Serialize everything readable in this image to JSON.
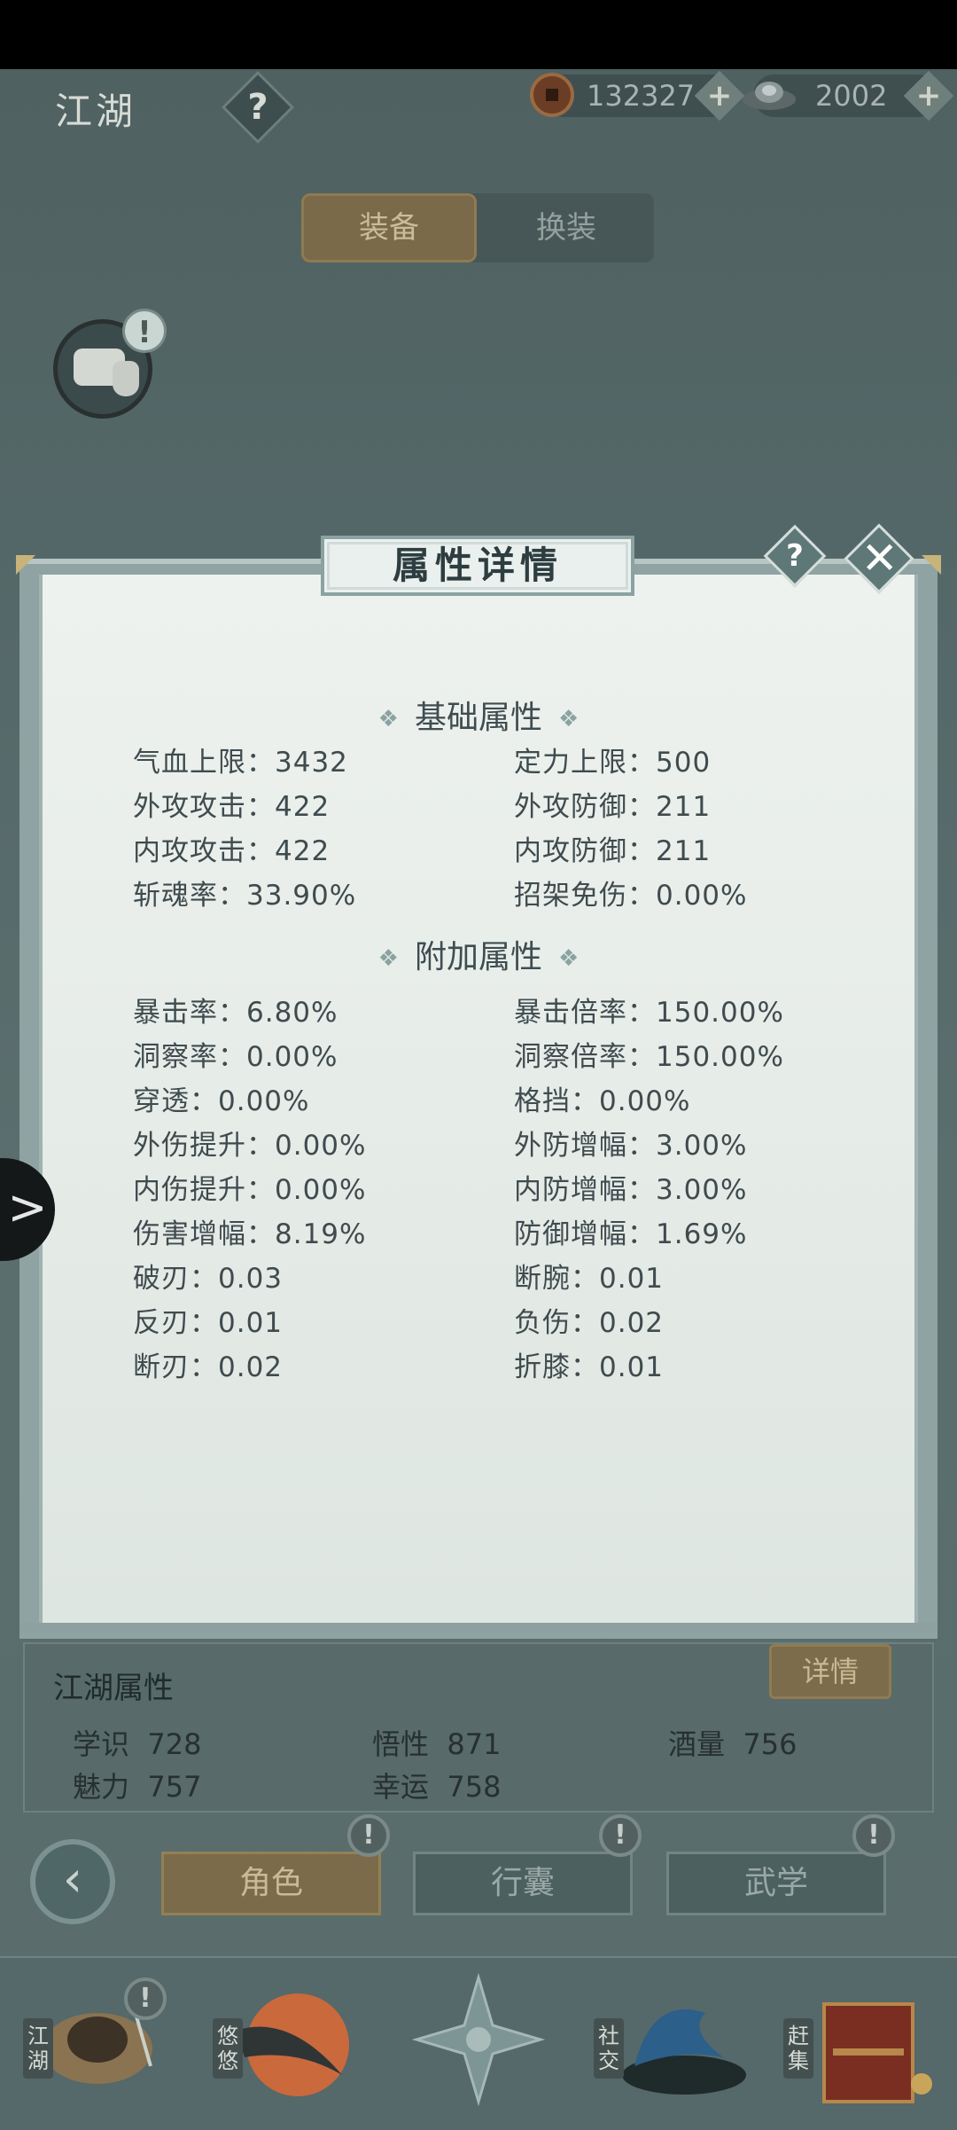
{
  "header": {
    "title": "江湖",
    "help": "?",
    "coins": "132327",
    "ingots": "2002",
    "plus": "+"
  },
  "tabs": {
    "equip": "装备",
    "change": "换装"
  },
  "chat": {
    "alert": "!"
  },
  "modal": {
    "title": "属性详情",
    "help": "?",
    "close": "✕",
    "base_section": "基础属性",
    "extra_section": "附加属性",
    "section_mark": "❖",
    "base_left": [
      "气血上限：3432",
      "外攻攻击：422",
      "内攻攻击：422",
      "斩魂率：33.90%"
    ],
    "base_right": [
      "定力上限：500",
      "外攻防御：211",
      "内攻防御：211",
      "招架免伤：0.00%"
    ],
    "extra_left": [
      "暴击率：6.80%",
      "洞察率：0.00%",
      "穿透：0.00%",
      "外伤提升：0.00%",
      "内伤提升：0.00%",
      "伤害增幅：8.19%",
      "破刃：0.03",
      "反刃：0.01",
      "断刃：0.02"
    ],
    "extra_right": [
      "暴击倍率：150.00%",
      "洞察倍率：150.00%",
      "格挡：0.00%",
      "外防增幅：3.00%",
      "内防增幅：3.00%",
      "防御增幅：1.69%",
      "断腕：0.01",
      "负伤：0.02",
      "折膝：0.01"
    ]
  },
  "side_arrow": ">",
  "jianghu": {
    "title": "江湖属性",
    "detail_button": "详情",
    "stats": [
      {
        "label": "学识",
        "value": "728"
      },
      {
        "label": "悟性",
        "value": "871"
      },
      {
        "label": "酒量",
        "value": "756"
      },
      {
        "label": "魅力",
        "value": "757"
      },
      {
        "label": "幸运",
        "value": "758"
      }
    ]
  },
  "nav": {
    "back": "‹",
    "tabs": [
      "角色",
      "行囊",
      "武学"
    ],
    "alert": "!"
  },
  "dock": {
    "items": [
      {
        "label": "江湖",
        "icon": "hat-icon"
      },
      {
        "label": "悠悠",
        "icon": "swallow-icon"
      },
      {
        "label": "",
        "icon": "compass-star-icon"
      },
      {
        "label": "社交",
        "icon": "wave-icon"
      },
      {
        "label": "赶集",
        "icon": "basket-icon"
      }
    ],
    "alert": "!"
  },
  "colors": {
    "accent_gold": "#7b6b4b",
    "panel_bg": "#eef2ef",
    "scene_bg": "#56696a"
  }
}
